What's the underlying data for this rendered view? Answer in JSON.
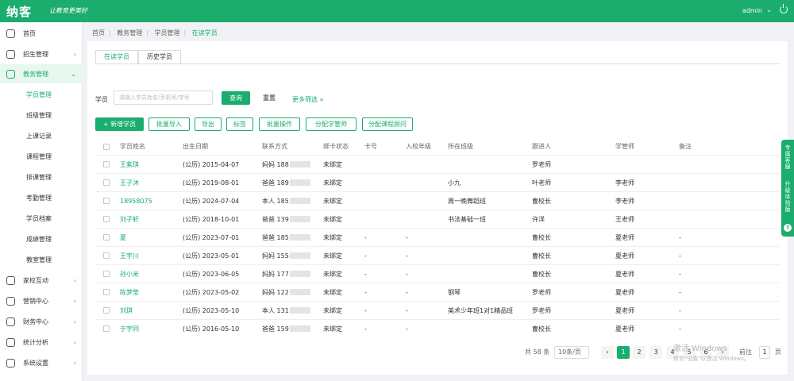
{
  "header": {
    "logo": "纳客",
    "slogan": "让教育更美好",
    "user": "admin"
  },
  "sidebar": {
    "items": [
      {
        "label": "首页",
        "arrow": ""
      },
      {
        "label": "招生管理",
        "arrow": "›"
      },
      {
        "label": "教务管理",
        "arrow": "⌄"
      },
      {
        "label": "家校互动",
        "arrow": "›"
      },
      {
        "label": "营销中心",
        "arrow": "›"
      },
      {
        "label": "财务中心",
        "arrow": "›"
      },
      {
        "label": "统计分析",
        "arrow": "›"
      },
      {
        "label": "系统设置",
        "arrow": "›"
      }
    ],
    "subitems": [
      "学员管理",
      "班级管理",
      "上课记录",
      "课程管理",
      "排课管理",
      "考勤管理",
      "学员档案",
      "成绩管理",
      "教室管理"
    ]
  },
  "breadcrumb": [
    "首页",
    "教务管理",
    "学员管理",
    "在读学员"
  ],
  "tabs": [
    "在读学员",
    "历史学员"
  ],
  "search": {
    "label": "学员",
    "placeholder": "请输入学员姓名/手机号/学号",
    "query_label": "查询",
    "reset_label": "重置",
    "more_label": "更多筛选 »"
  },
  "actions": [
    "+ 新增学员",
    "批量导入",
    "导出",
    "标签",
    "批量操作",
    "分配学管师",
    "分配课程顾问"
  ],
  "table": {
    "columns": [
      "学员姓名",
      "出生日期",
      "联系方式",
      "绑卡状态",
      "卡号",
      "入校年级",
      "所在班级",
      "跟进人",
      "学管师",
      "备注"
    ],
    "rows": [
      {
        "name": "王紫琪",
        "birth": "(公历) 2015-04-07",
        "phone": "妈妈 188",
        "bind": "未绑定",
        "card": "",
        "grade": "",
        "cls": "",
        "follow": "罗老师",
        "manager": "",
        "note": ""
      },
      {
        "name": "王子沐",
        "birth": "(公历) 2019-08-01",
        "phone": "爸爸 189",
        "bind": "未绑定",
        "card": "",
        "grade": "",
        "cls": "小九",
        "follow": "叶老师",
        "manager": "李老师",
        "note": ""
      },
      {
        "name": "18958075",
        "birth": "(公历) 2024-07-04",
        "phone": "本人 185",
        "bind": "未绑定",
        "card": "",
        "grade": "",
        "cls": "周一晚舞蹈班",
        "follow": "曹校长",
        "manager": "李老师",
        "note": ""
      },
      {
        "name": "刘子轩",
        "birth": "(公历) 2018-10-01",
        "phone": "爸爸 139",
        "bind": "未绑定",
        "card": "",
        "grade": "",
        "cls": "书法基础一班",
        "follow": "许洋",
        "manager": "王老师",
        "note": ""
      },
      {
        "name": "夏",
        "birth": "(公历) 2023-07-01",
        "phone": "爸爸 185",
        "bind": "未绑定",
        "card": "-",
        "grade": "-",
        "cls": "",
        "follow": "曹校长",
        "manager": "夏老师",
        "note": "-"
      },
      {
        "name": "王宇川",
        "birth": "(公历) 2023-05-01",
        "phone": "妈妈 155",
        "bind": "未绑定",
        "card": "-",
        "grade": "-",
        "cls": "",
        "follow": "曹校长",
        "manager": "夏老师",
        "note": "-"
      },
      {
        "name": "孙小米",
        "birth": "(公历) 2023-06-05",
        "phone": "妈妈 177",
        "bind": "未绑定",
        "card": "-",
        "grade": "-",
        "cls": "",
        "follow": "曹校长",
        "manager": "夏老师",
        "note": "-"
      },
      {
        "name": "陈梦莹",
        "birth": "(公历) 2023-05-02",
        "phone": "妈妈 122",
        "bind": "未绑定",
        "card": "-",
        "grade": "-",
        "cls": "钢琴",
        "follow": "罗老师",
        "manager": "夏老师",
        "note": "-"
      },
      {
        "name": "刘琪",
        "birth": "(公历) 2023-05-10",
        "phone": "本人 131",
        "bind": "未绑定",
        "card": "-",
        "grade": "-",
        "cls": "美术少年班1对1精品班",
        "follow": "罗老师",
        "manager": "夏老师",
        "note": "-"
      },
      {
        "name": "于宇同",
        "birth": "(公历) 2016-05-10",
        "phone": "爸爸 159",
        "bind": "未绑定",
        "card": "-",
        "grade": "-",
        "cls": "",
        "follow": "曹校长",
        "manager": "夏老师",
        "note": "-"
      }
    ]
  },
  "pagination": {
    "total": "共 58 条",
    "size": "10条/页",
    "prev": "‹",
    "next": "›",
    "pages": [
      "1",
      "2",
      "3",
      "4",
      "5",
      "6"
    ],
    "current": "1",
    "goto": "前往",
    "goto_value": "1",
    "goto_unit": "页"
  },
  "watermark": {
    "line1": "激活 Windows",
    "line2": "转到\"设置\"以激活 Windows。"
  },
  "float_bar": {
    "text1": "专属客服",
    "text2": "升级体验版",
    "icon": "?"
  }
}
